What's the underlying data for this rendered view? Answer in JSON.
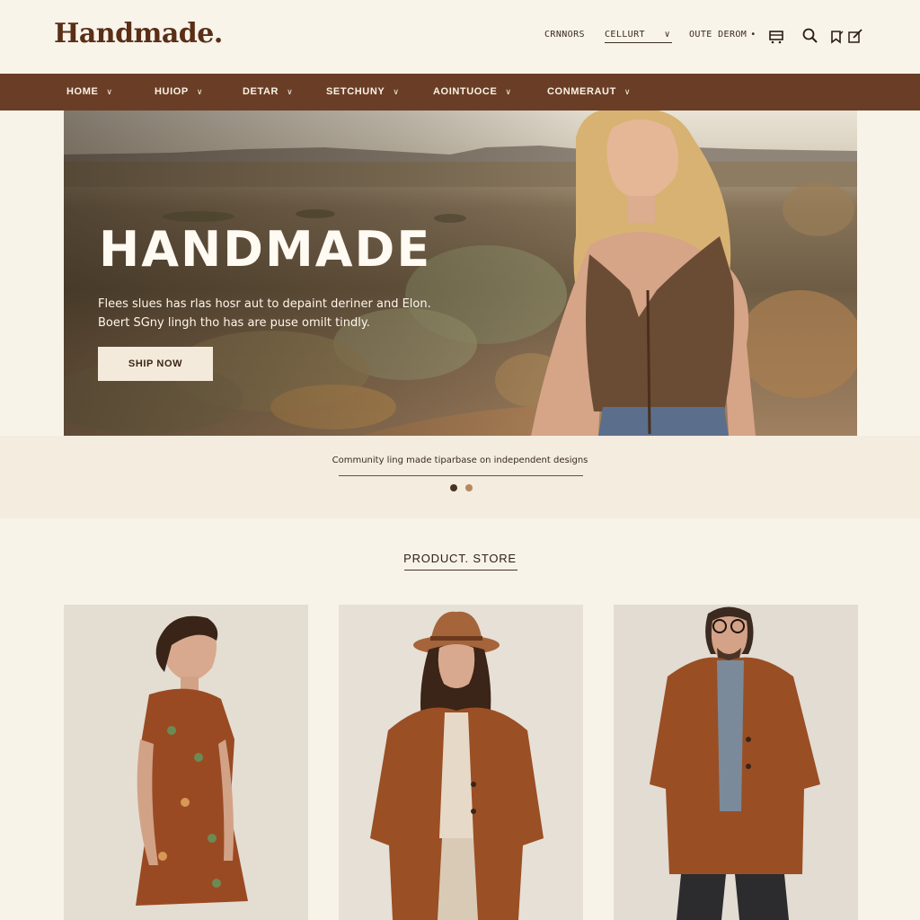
{
  "header": {
    "logo": "Handmade.",
    "links": [
      {
        "label": "CRNNORS"
      },
      {
        "label": "CELLURT"
      },
      {
        "label": "OUTE DEROM"
      }
    ],
    "icons": [
      "cart-icon",
      "search-icon",
      "bag-icon",
      "edit-icon"
    ]
  },
  "nav": {
    "items": [
      {
        "label": "HOME"
      },
      {
        "label": "HUIOP"
      },
      {
        "label": "DETAR"
      },
      {
        "label": "SETCHUNY"
      },
      {
        "label": "AOINTUOCE"
      },
      {
        "label": "CONMERAUT"
      }
    ]
  },
  "hero": {
    "title": "HANDMADE",
    "subtitle_line1": "Flees slues has rlas hosr aut to depaint deriner and Elon.",
    "subtitle_line2": "Boert SGny lingh tho has are puse omilt tindly.",
    "button_label": "SHIP NOW",
    "caption": "Community ling made tiparbase on independent designs",
    "slide_count": 2,
    "active_slide": 1
  },
  "products": {
    "section_title": "PRODUCT. STORE",
    "items": [
      {
        "name": "floral-wrap-dress"
      },
      {
        "name": "rust-wool-coat-with-hat"
      },
      {
        "name": "rust-mens-overcoat"
      }
    ]
  },
  "colors": {
    "background": "#f8f3e9",
    "nav_bar": "#6a3e26",
    "logo": "#5a2e17",
    "button_bg": "#f3eadb",
    "accent_rust": "#a0522d"
  }
}
